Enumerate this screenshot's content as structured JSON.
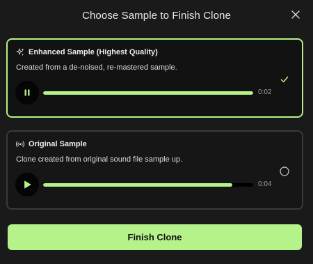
{
  "dialog": {
    "title": "Choose Sample to Finish Clone",
    "close_icon": "close-icon",
    "finish_label": "Finish Clone"
  },
  "colors": {
    "accent": "#b5f28a",
    "background": "#1a1a1a",
    "card_selected_border": "#b5f28a",
    "card_border": "#3a3a3a"
  },
  "samples": [
    {
      "title": "Enhanced Sample (Highest Quality)",
      "description": "Created from a de-noised, re-mastered sample.",
      "icon": "sparkles-icon",
      "player_state": "playing",
      "player_icon": "pause-icon",
      "progress": 1.0,
      "time": "0:02",
      "selected": true,
      "select_icon": "check-icon"
    },
    {
      "title": "Original Sample",
      "description": "Clone created from original sound file sample up.",
      "icon": "broadcast-icon",
      "player_state": "paused",
      "player_icon": "play-icon",
      "progress": 0.9,
      "time": "0:04",
      "selected": false,
      "select_icon": "radio-circle-icon"
    }
  ]
}
